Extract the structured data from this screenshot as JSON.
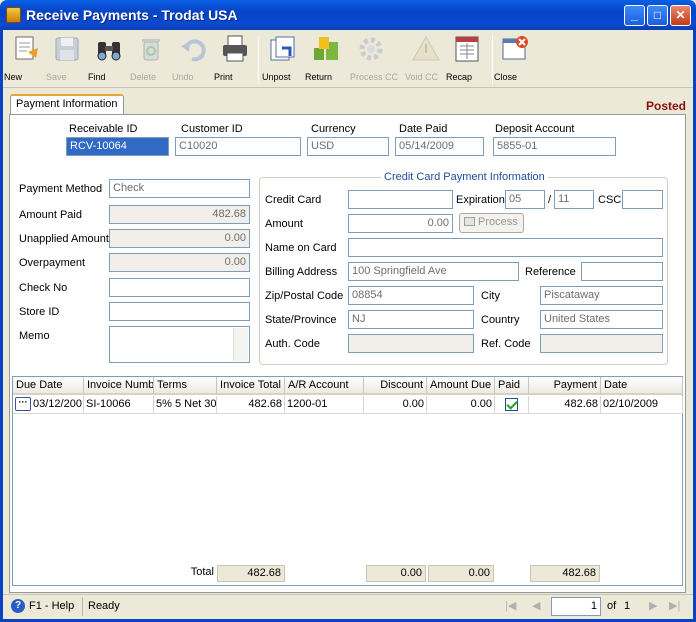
{
  "window": {
    "title": "Receive Payments - Trodat USA",
    "min": "_",
    "max": "□",
    "close": "✕"
  },
  "toolbar": [
    {
      "label": "New",
      "icon": "new-icon",
      "enabled": true
    },
    {
      "label": "Save",
      "icon": "save-icon",
      "enabled": false
    },
    {
      "label": "Find",
      "icon": "find-icon",
      "enabled": true
    },
    {
      "label": "Delete",
      "icon": "delete-icon",
      "enabled": false
    },
    {
      "label": "Undo",
      "icon": "undo-icon",
      "enabled": false
    },
    {
      "label": "Print",
      "icon": "print-icon",
      "enabled": true
    },
    {
      "label": "Unpost",
      "icon": "unpost-icon",
      "enabled": true
    },
    {
      "label": "Return",
      "icon": "return-icon",
      "enabled": true
    },
    {
      "label": "Process CC",
      "icon": "process-cc-icon",
      "enabled": false
    },
    {
      "label": "Void CC",
      "icon": "void-cc-icon",
      "enabled": false
    },
    {
      "label": "Recap",
      "icon": "recap-icon",
      "enabled": true
    },
    {
      "label": "Close",
      "icon": "close-icon",
      "enabled": true
    }
  ],
  "tab": {
    "label": "Payment Information"
  },
  "status_label": "Posted",
  "header": {
    "receivable_id_label": "Receivable ID",
    "receivable_id": "RCV-10064",
    "customer_id_label": "Customer ID",
    "customer_id": "C10020",
    "currency_label": "Currency",
    "currency": "USD",
    "date_paid_label": "Date Paid",
    "date_paid": "05/14/2009",
    "deposit_account_label": "Deposit Account",
    "deposit_account": "5855-01"
  },
  "left": {
    "payment_method_label": "Payment Method",
    "payment_method": "Check",
    "amount_paid_label": "Amount Paid",
    "amount_paid": "482.68",
    "unapplied_label": "Unapplied Amount",
    "unapplied": "0.00",
    "overpayment_label": "Overpayment",
    "overpayment": "0.00",
    "check_no_label": "Check No",
    "check_no": "",
    "store_id_label": "Store ID",
    "store_id": "",
    "memo_label": "Memo",
    "memo": ""
  },
  "cc": {
    "group_title": "Credit Card Payment Information",
    "credit_card_label": "Credit Card",
    "credit_card": "",
    "expiration_label": "Expiration",
    "exp_year": "05",
    "exp_sep": "/",
    "exp_month": "11",
    "csc_label": "CSC",
    "csc": "",
    "amount_label": "Amount",
    "amount": "0.00",
    "process_label": "Process",
    "name_on_card_label": "Name on Card",
    "name_on_card": "",
    "billing_address_label": "Billing Address",
    "billing_address": "100 Springfield Ave",
    "reference_label": "Reference",
    "reference": "",
    "zip_label": "Zip/Postal Code",
    "zip": "08854",
    "city_label": "City",
    "city": "Piscataway",
    "state_label": "State/Province",
    "state": "NJ",
    "country_label": "Country",
    "country": "United States",
    "auth_code_label": "Auth. Code",
    "auth_code": "",
    "ref_code_label": "Ref. Code",
    "ref_code": ""
  },
  "grid": {
    "columns": [
      "Due Date",
      "Invoice Numb",
      "Terms",
      "Invoice Total",
      "A/R Account",
      "Discount",
      "Amount Due",
      "Paid",
      "Payment",
      "Date"
    ],
    "rows": [
      {
        "due_date": "03/12/200",
        "invoice": "SI-10066",
        "terms": "5% 5 Net 30",
        "invoice_total": "482.68",
        "ar_account": "1200-01",
        "discount": "0.00",
        "amount_due": "0.00",
        "paid": true,
        "payment": "482.68",
        "date": "02/10/2009",
        "lookup": "···"
      }
    ],
    "totals": {
      "label": "Total",
      "invoice_total": "482.68",
      "discount": "0.00",
      "amount_due": "0.00",
      "payment": "482.68"
    }
  },
  "statusbar": {
    "help": "F1 - Help",
    "status": "Ready",
    "page": "1",
    "of_label": "of",
    "page_count": "1"
  }
}
